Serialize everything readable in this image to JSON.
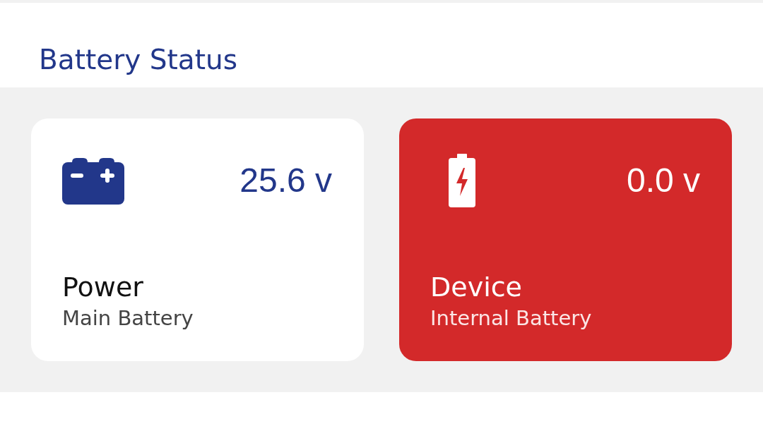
{
  "header": {
    "title": "Battery Status"
  },
  "cards": [
    {
      "kind": "car-battery",
      "alert": false,
      "reading": "25.6 v",
      "title": "Power",
      "subtitle": "Main Battery"
    },
    {
      "kind": "charging-battery",
      "alert": true,
      "reading": "0.0 v",
      "title": "Device",
      "subtitle": "Internal Battery"
    }
  ]
}
